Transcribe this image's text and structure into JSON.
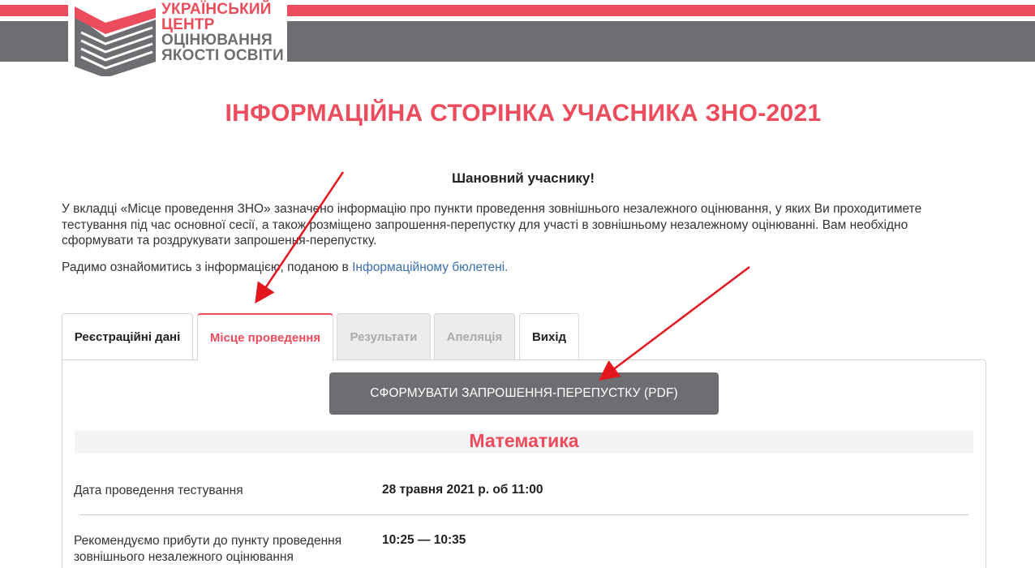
{
  "header": {
    "logo_lines": [
      "УКРАЇНСЬКИЙ",
      "ЦЕНТР",
      "ОЦІНЮВАННЯ",
      "ЯКОСТІ ОСВІТИ"
    ],
    "colors": {
      "accent": "#ed4c5c",
      "gray": "#6d6e71",
      "link": "#3a6fb0"
    }
  },
  "page": {
    "title": "ІНФОРМАЦІЙНА СТОРІНКА УЧАСНИКА ЗНО-2021",
    "greeting": "Шановний учаснику!",
    "intro": "У вкладці «Місце проведення ЗНО» зазначено інформацію про пункти проведення зовнішнього незалежного оцінювання, у яких Ви проходитимете тестування під час основної сесії, а також розміщено запрошення-перепустку для участі в зовнішньому незалежному оцінюванні. Вам необхідно сформувати та роздрукувати запрошення-перепустку.",
    "info_prefix": "Радимо ознайомитись з інформацією, поданою в ",
    "info_link": "Інформаційному бюлетені."
  },
  "tabs": [
    {
      "label": "Реєстраційні дані",
      "state": "normal"
    },
    {
      "label": "Місце проведення",
      "state": "active"
    },
    {
      "label": "Результати",
      "state": "disabled"
    },
    {
      "label": "Апеляція",
      "state": "disabled"
    },
    {
      "label": "Вихід",
      "state": "normal"
    }
  ],
  "panel": {
    "button_label": "СФОРМУВАТИ ЗАПРОШЕННЯ-ПЕРЕПУСТКУ (PDF)",
    "subject": "Математика",
    "rows": [
      {
        "label": "Дата проведення тестування",
        "value": "28 травня 2021 р. об 11:00"
      },
      {
        "label": "Рекомендуємо прибути до пункту проведення зовнішнього незалежного оцінювання",
        "value": "10:25 — 10:35"
      }
    ]
  }
}
